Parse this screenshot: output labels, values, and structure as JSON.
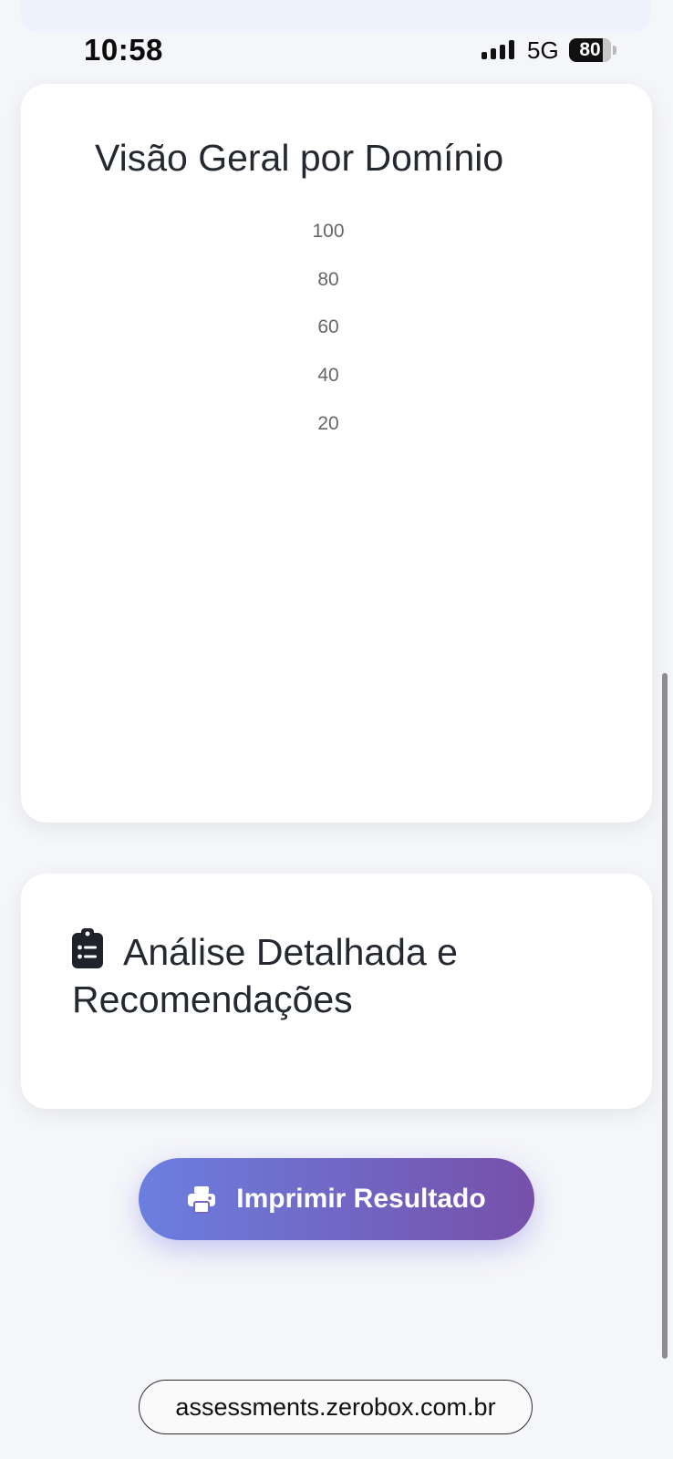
{
  "status_bar": {
    "time": "10:58",
    "network": "5G",
    "battery_level": "80",
    "battery_fraction": 0.8
  },
  "chart_card": {
    "title": "Visão Geral por Domínio",
    "ticks": [
      "100",
      "80",
      "60",
      "40",
      "20"
    ]
  },
  "chart_data": {
    "type": "bar",
    "title": "Visão Geral por Domínio",
    "y_ticks": [
      100,
      80,
      60,
      40,
      20
    ],
    "categories": [],
    "values": []
  },
  "analysis_card": {
    "icon": "clipboard-list-icon",
    "title": "Análise Detalhada e Recomendações"
  },
  "print_button": {
    "icon": "printer-icon",
    "label": "Imprimir Resultado"
  },
  "browser": {
    "url": "assessments.zerobox.com.br"
  },
  "colors": {
    "background": "#f5f6f9",
    "card": "#ffffff",
    "button_gradient_start": "#6b7fe0",
    "button_gradient_end": "#7650aa",
    "text": "#24292f",
    "tick": "#666666"
  }
}
